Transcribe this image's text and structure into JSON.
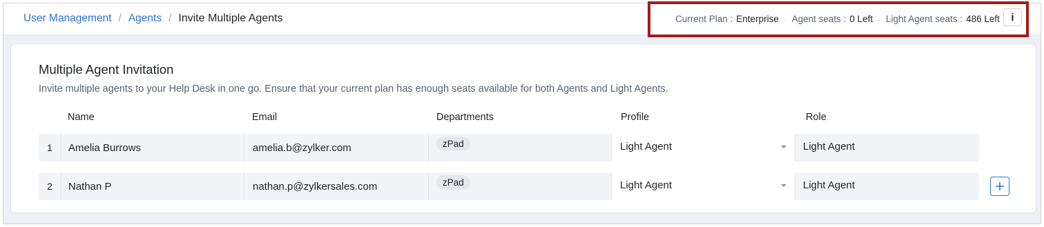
{
  "breadcrumb": {
    "items": [
      "User Management",
      "Agents"
    ],
    "current": "Invite Multiple Agents",
    "separator": "/"
  },
  "plan": {
    "current_plan_label": "Current Plan :",
    "current_plan_value": "Enterprise",
    "agent_seats_label": "Agent seats :",
    "agent_seats_value": "0 Left",
    "light_agent_seats_label": "Light Agent seats :",
    "light_agent_seats_value": "486 Left",
    "separator": ".",
    "more_icon": "info-icon",
    "more_glyph": "i"
  },
  "invitation": {
    "title": "Multiple Agent Invitation",
    "description": "Invite multiple agents to your Help Desk in one go. Ensure that your current plan has enough seats available for both Agents and Light Agents.",
    "columns": [
      "Name",
      "Email",
      "Departments",
      "Profile",
      "Role"
    ],
    "rows": [
      {
        "num": "1",
        "name": "Amelia Burrows",
        "email": "amelia.b@zylker.com",
        "department": "zPad",
        "profile": "Light Agent",
        "role": "Light Agent"
      },
      {
        "num": "2",
        "name": "Nathan P",
        "email": "nathan.p@zylkersales.com",
        "department": "zPad",
        "profile": "Light Agent",
        "role": "Light Agent"
      }
    ],
    "add_icon": "plus-icon"
  },
  "colors": {
    "link": "#2b74d8",
    "highlight_border": "#a11b1b",
    "page_bg": "#eef0f5"
  }
}
